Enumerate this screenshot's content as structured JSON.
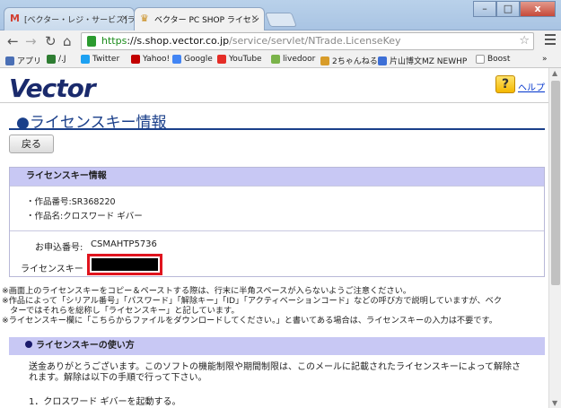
{
  "browser": {
    "tabs": [
      {
        "title": "[ベクター・レジ・サービス]ライセ",
        "icon": "M"
      },
      {
        "title": "ベクター PC SHOP ライセン"
      }
    ],
    "url_scheme": "https",
    "url_host": "://s.shop.vector.co.jp",
    "url_path": "/service/servlet/NTrade.LicenseKey",
    "bookmarks": [
      {
        "label": "アプリ",
        "color": "#4a6fb5"
      },
      {
        "label": "/.J",
        "color": "#2e7d32"
      },
      {
        "label": "Twitter",
        "color": "#1da1f2"
      },
      {
        "label": "Yahoo!",
        "color": "#c20000"
      },
      {
        "label": "Google",
        "color": "#4285f4"
      },
      {
        "label": "YouTube",
        "color": "#e52d27"
      },
      {
        "label": "livedoor",
        "color": "#7ab34a"
      },
      {
        "label": "2ちゃんねる",
        "color": "#d89c2a"
      },
      {
        "label": "片山博文MZ NEWHP",
        "color": "#3d6fd6"
      },
      {
        "label": "Boost",
        "color": "#bbbbbb"
      }
    ],
    "bookmarks_more": "»"
  },
  "page": {
    "logo": "Vector",
    "help_link": "ヘルプ",
    "help_icon_glyph": "?",
    "title": "●ライセンスキー情報",
    "back_button": "戻る",
    "box": {
      "header": "ライセンスキー情報",
      "product_number": "・作品番号:SR368220",
      "product_name": "・作品名:クロスワード ギバー",
      "order_label": "お申込番号:",
      "order_value": "CSMAHTP5736",
      "license_key_label": "ライセンスキー"
    },
    "notes": [
      "※画面上のライセンスキーをコピー＆ペーストする際は、行末に半角スペースが入らないようご注意ください。",
      "※作品によって「シリアル番号」「パスワード」「解除キー」「ID」「アクティベーションコード」などの呼び方で説明していますが、ベク",
      "　ターではそれらを総称し「ライセンスキー」と記しています。",
      "※ライセンスキー欄に「こちらからファイルをダウンロードしてください。」と書いてある場合は、ライセンスキーの入力は不要です。"
    ],
    "section": {
      "title": "ライセンスキーの使い方",
      "body": [
        "送金ありがとうございます。このソフトの機能制限や期間制限は、このメールに記載されたライセンスキーによって解除さ",
        "れます。解除は以下の手順で行って下さい。"
      ],
      "step1": "1．クロスワード ギバーを起動する。"
    }
  }
}
